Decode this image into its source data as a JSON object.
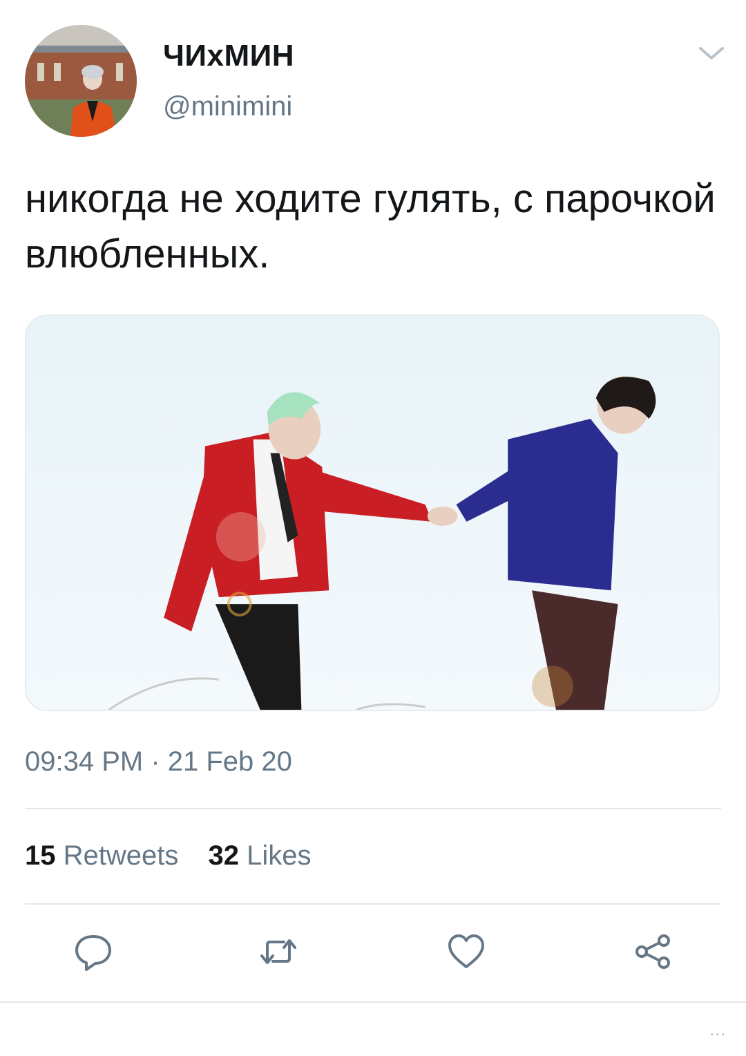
{
  "user": {
    "display_name": "ЧИхМИН",
    "handle": "@minimini",
    "avatar_icon": "profile-photo"
  },
  "tweet": {
    "text": "никогда не ходите гулять, с парочкой влюбленных.",
    "media_icon": "photo-two-people-holding-hands",
    "timestamp": "09:34 PM · 21 Feb 20"
  },
  "stats": {
    "retweets_count": "15",
    "retweets_label": "Retweets",
    "likes_count": "32",
    "likes_label": "Likes"
  },
  "actions": {
    "reply_icon": "reply-icon",
    "retweet_icon": "retweet-icon",
    "like_icon": "heart-icon",
    "share_icon": "share-icon"
  },
  "colors": {
    "text_primary": "#14171a",
    "text_secondary": "#657786",
    "divider": "#e1e8ed"
  }
}
